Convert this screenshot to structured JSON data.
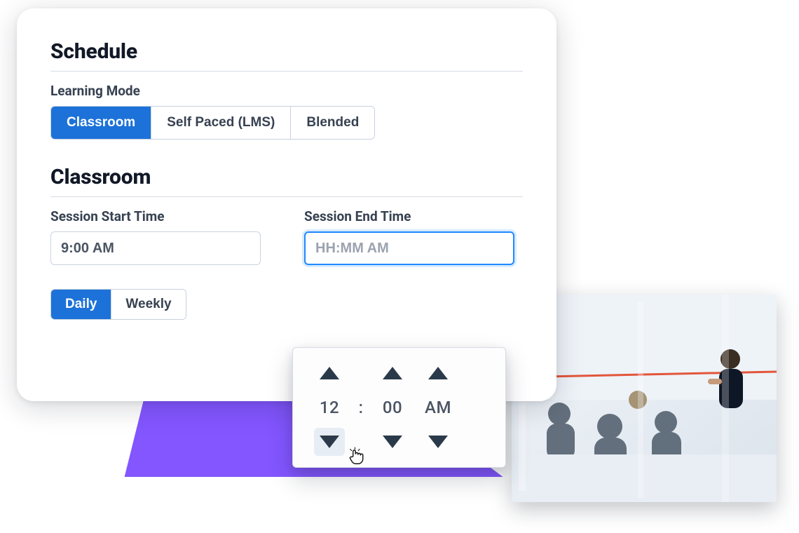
{
  "schedule": {
    "title": "Schedule",
    "learning_mode_label": "Learning Mode",
    "modes": [
      {
        "label": "Classroom",
        "active": true
      },
      {
        "label": "Self Paced (LMS)",
        "active": false
      },
      {
        "label": "Blended",
        "active": false
      }
    ]
  },
  "classroom": {
    "title": "Classroom",
    "start_label": "Session Start Time",
    "start_value": "9:00 AM",
    "end_label": "Session End Time",
    "end_placeholder": "HH:MM AM",
    "frequency": [
      {
        "label": "Daily",
        "active": true
      },
      {
        "label": "Weekly",
        "active": false
      }
    ]
  },
  "time_picker": {
    "hour": "12",
    "separator": ":",
    "minute": "00",
    "meridiem": "AM"
  },
  "colors": {
    "primary": "#1c72d8",
    "focus": "#1f89ff",
    "wedge": "#7c4dff",
    "text": "#111827",
    "muted": "#4b5563"
  }
}
